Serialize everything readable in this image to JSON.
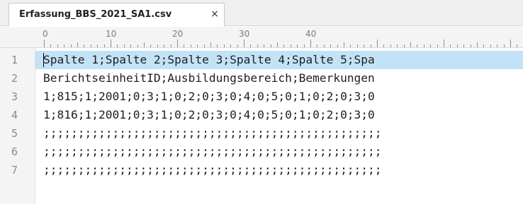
{
  "tab": {
    "title": "Erfassung_BBS_2021_SA1.csv",
    "close_glyph": "×"
  },
  "ruler": {
    "labels": [
      "0",
      "10",
      "20",
      "30",
      "40"
    ]
  },
  "editor": {
    "line_numbers": [
      "1",
      "2",
      "3",
      "4",
      "5",
      "6",
      "7"
    ],
    "lines": [
      "Spalte 1;Spalte 2;Spalte 3;Spalte 4;Spalte 5;Spa",
      "BerichtseinheitID;Ausbildungsbereich;Bemerkungen",
      "1;815;1;2001;0;3;1;0;2;0;3;0;4;0;5;0;1;0;2;0;3;0",
      "1;816;1;2001;0;3;1;0;2;0;3;0;4;0;5;0;1;0;2;0;3;0",
      ";;;;;;;;;;;;;;;;;;;;;;;;;;;;;;;;;;;;;;;;;;;;;;;;;",
      ";;;;;;;;;;;;;;;;;;;;;;;;;;;;;;;;;;;;;;;;;;;;;;;;;",
      ";;;;;;;;;;;;;;;;;;;;;;;;;;;;;;;;;;;;;;;;;;;;;;;;;"
    ],
    "current_line": 1
  },
  "colors": {
    "current_line_highlight": "#c2e3f7",
    "gutter_background": "#f4f4f4",
    "line_number": "#8a8a8a",
    "text": "#1e1e1e"
  }
}
